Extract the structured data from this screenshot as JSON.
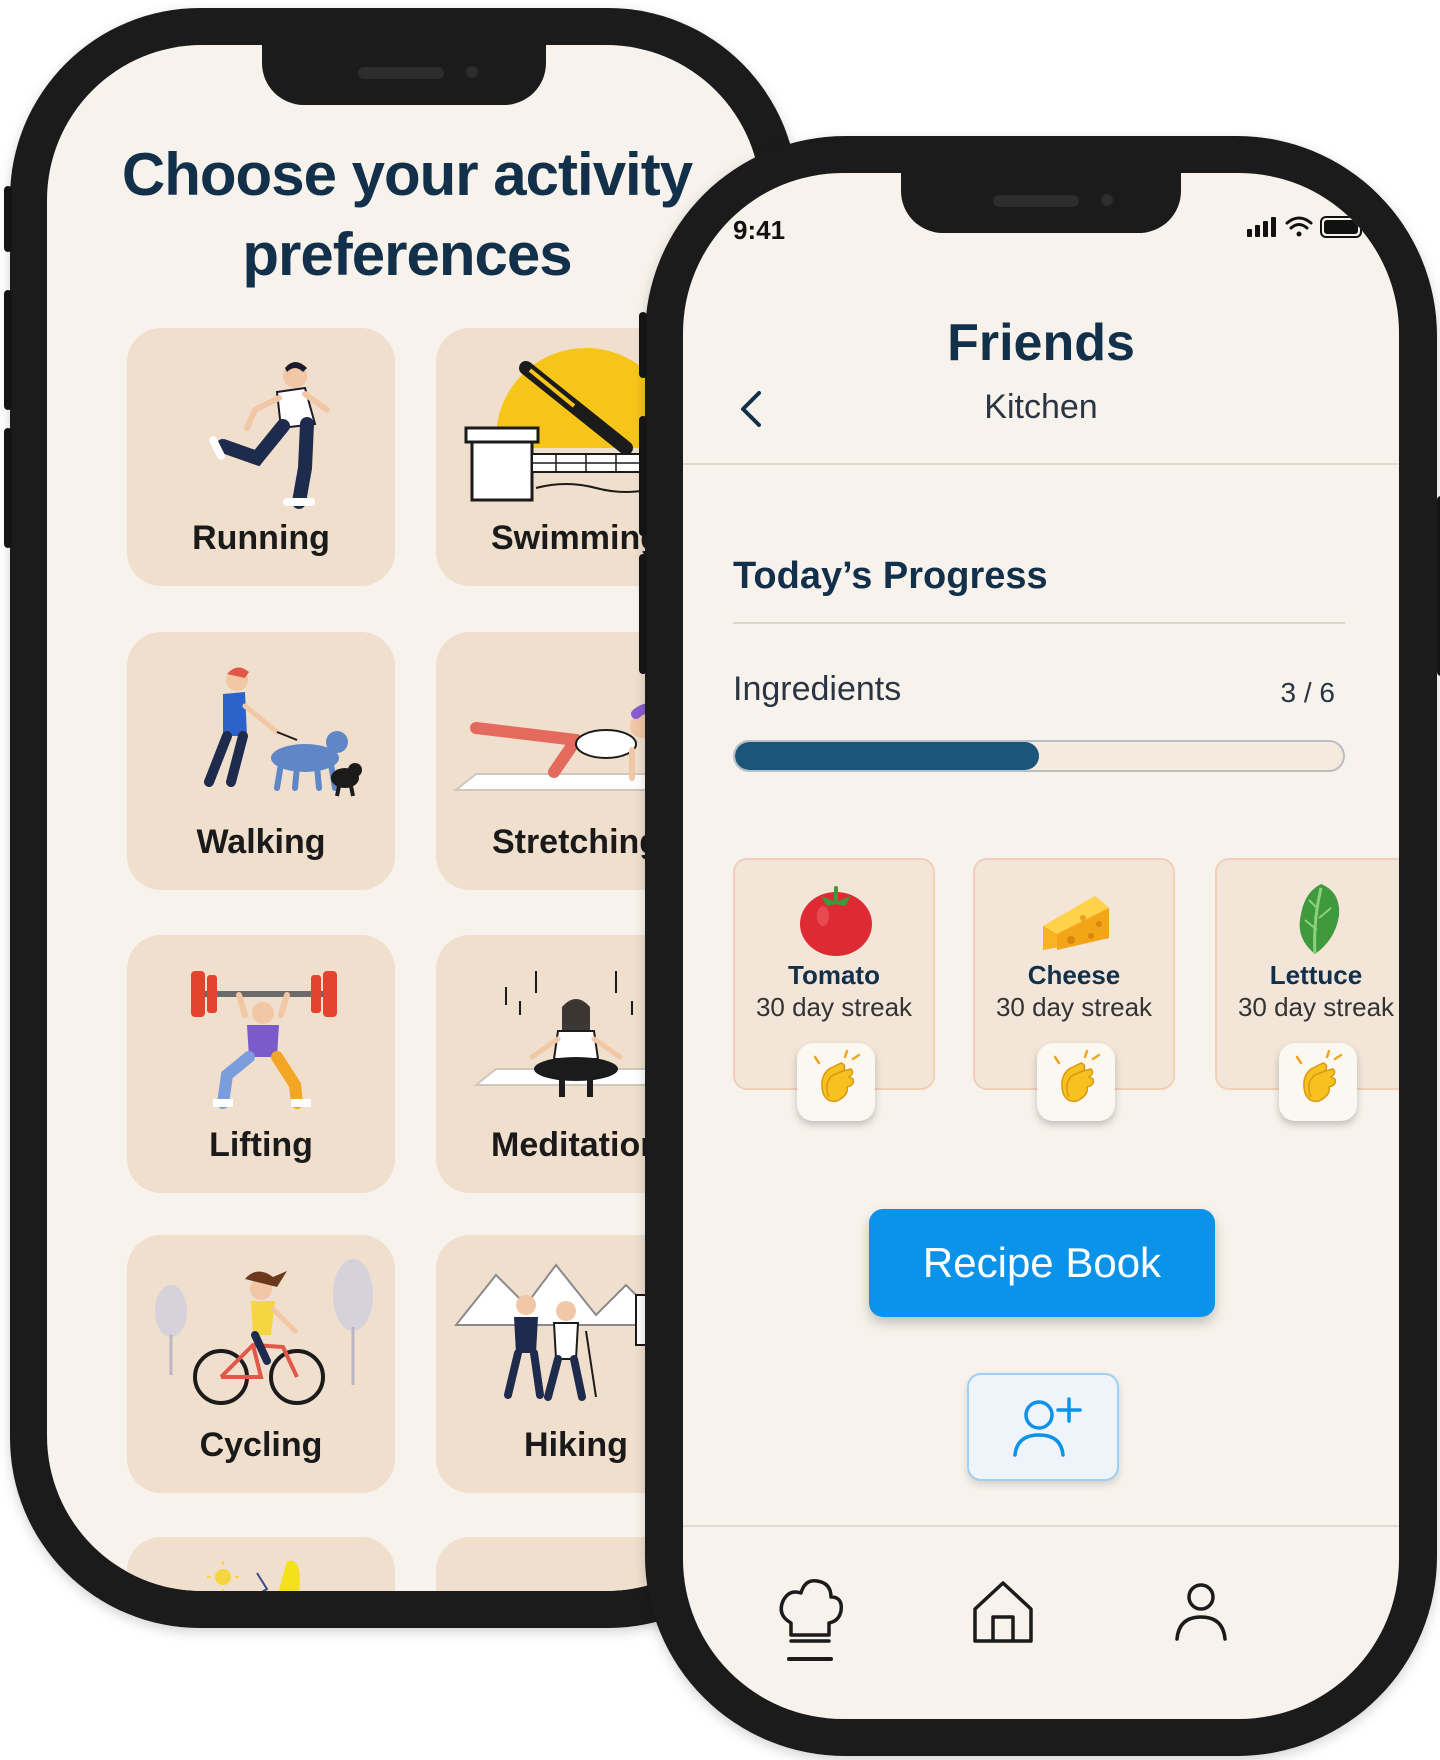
{
  "activities": {
    "title_line1": "Choose your activity",
    "title_line2": "preferences",
    "items": [
      {
        "label": "Running"
      },
      {
        "label": "Swimming"
      },
      {
        "label": "Walking"
      },
      {
        "label": "Stretching"
      },
      {
        "label": "Lifting"
      },
      {
        "label": "Meditation"
      },
      {
        "label": "Cycling"
      },
      {
        "label": "Hiking"
      }
    ]
  },
  "status_bar": {
    "time": "9:41",
    "icons": [
      "signal-icon",
      "wifi-icon",
      "battery-icon"
    ]
  },
  "header": {
    "title": "Friends",
    "subtitle": "Kitchen",
    "back_icon": "chevron-left-icon"
  },
  "progress": {
    "section_title": "Today’s Progress",
    "label": "Ingredients",
    "count_text": "3 / 6",
    "fraction": 0.5,
    "fill_color": "#1a5679"
  },
  "ingredients": [
    {
      "name": "Tomato",
      "streak": "30 day streak",
      "icon": "tomato-icon"
    },
    {
      "name": "Cheese",
      "streak": "30 day streak",
      "icon": "cheese-icon"
    },
    {
      "name": "Lettuce",
      "streak": "30 day streak",
      "icon": "lettuce-icon"
    }
  ],
  "actions": {
    "recipe_book_label": "Recipe Book",
    "add_friend_icon": "add-user-icon",
    "accent_color": "#0a93e8"
  },
  "tab_bar": {
    "items": [
      {
        "icon": "chef-hat-icon",
        "active": true
      },
      {
        "icon": "home-icon",
        "active": false
      },
      {
        "icon": "profile-icon",
        "active": false
      }
    ]
  }
}
